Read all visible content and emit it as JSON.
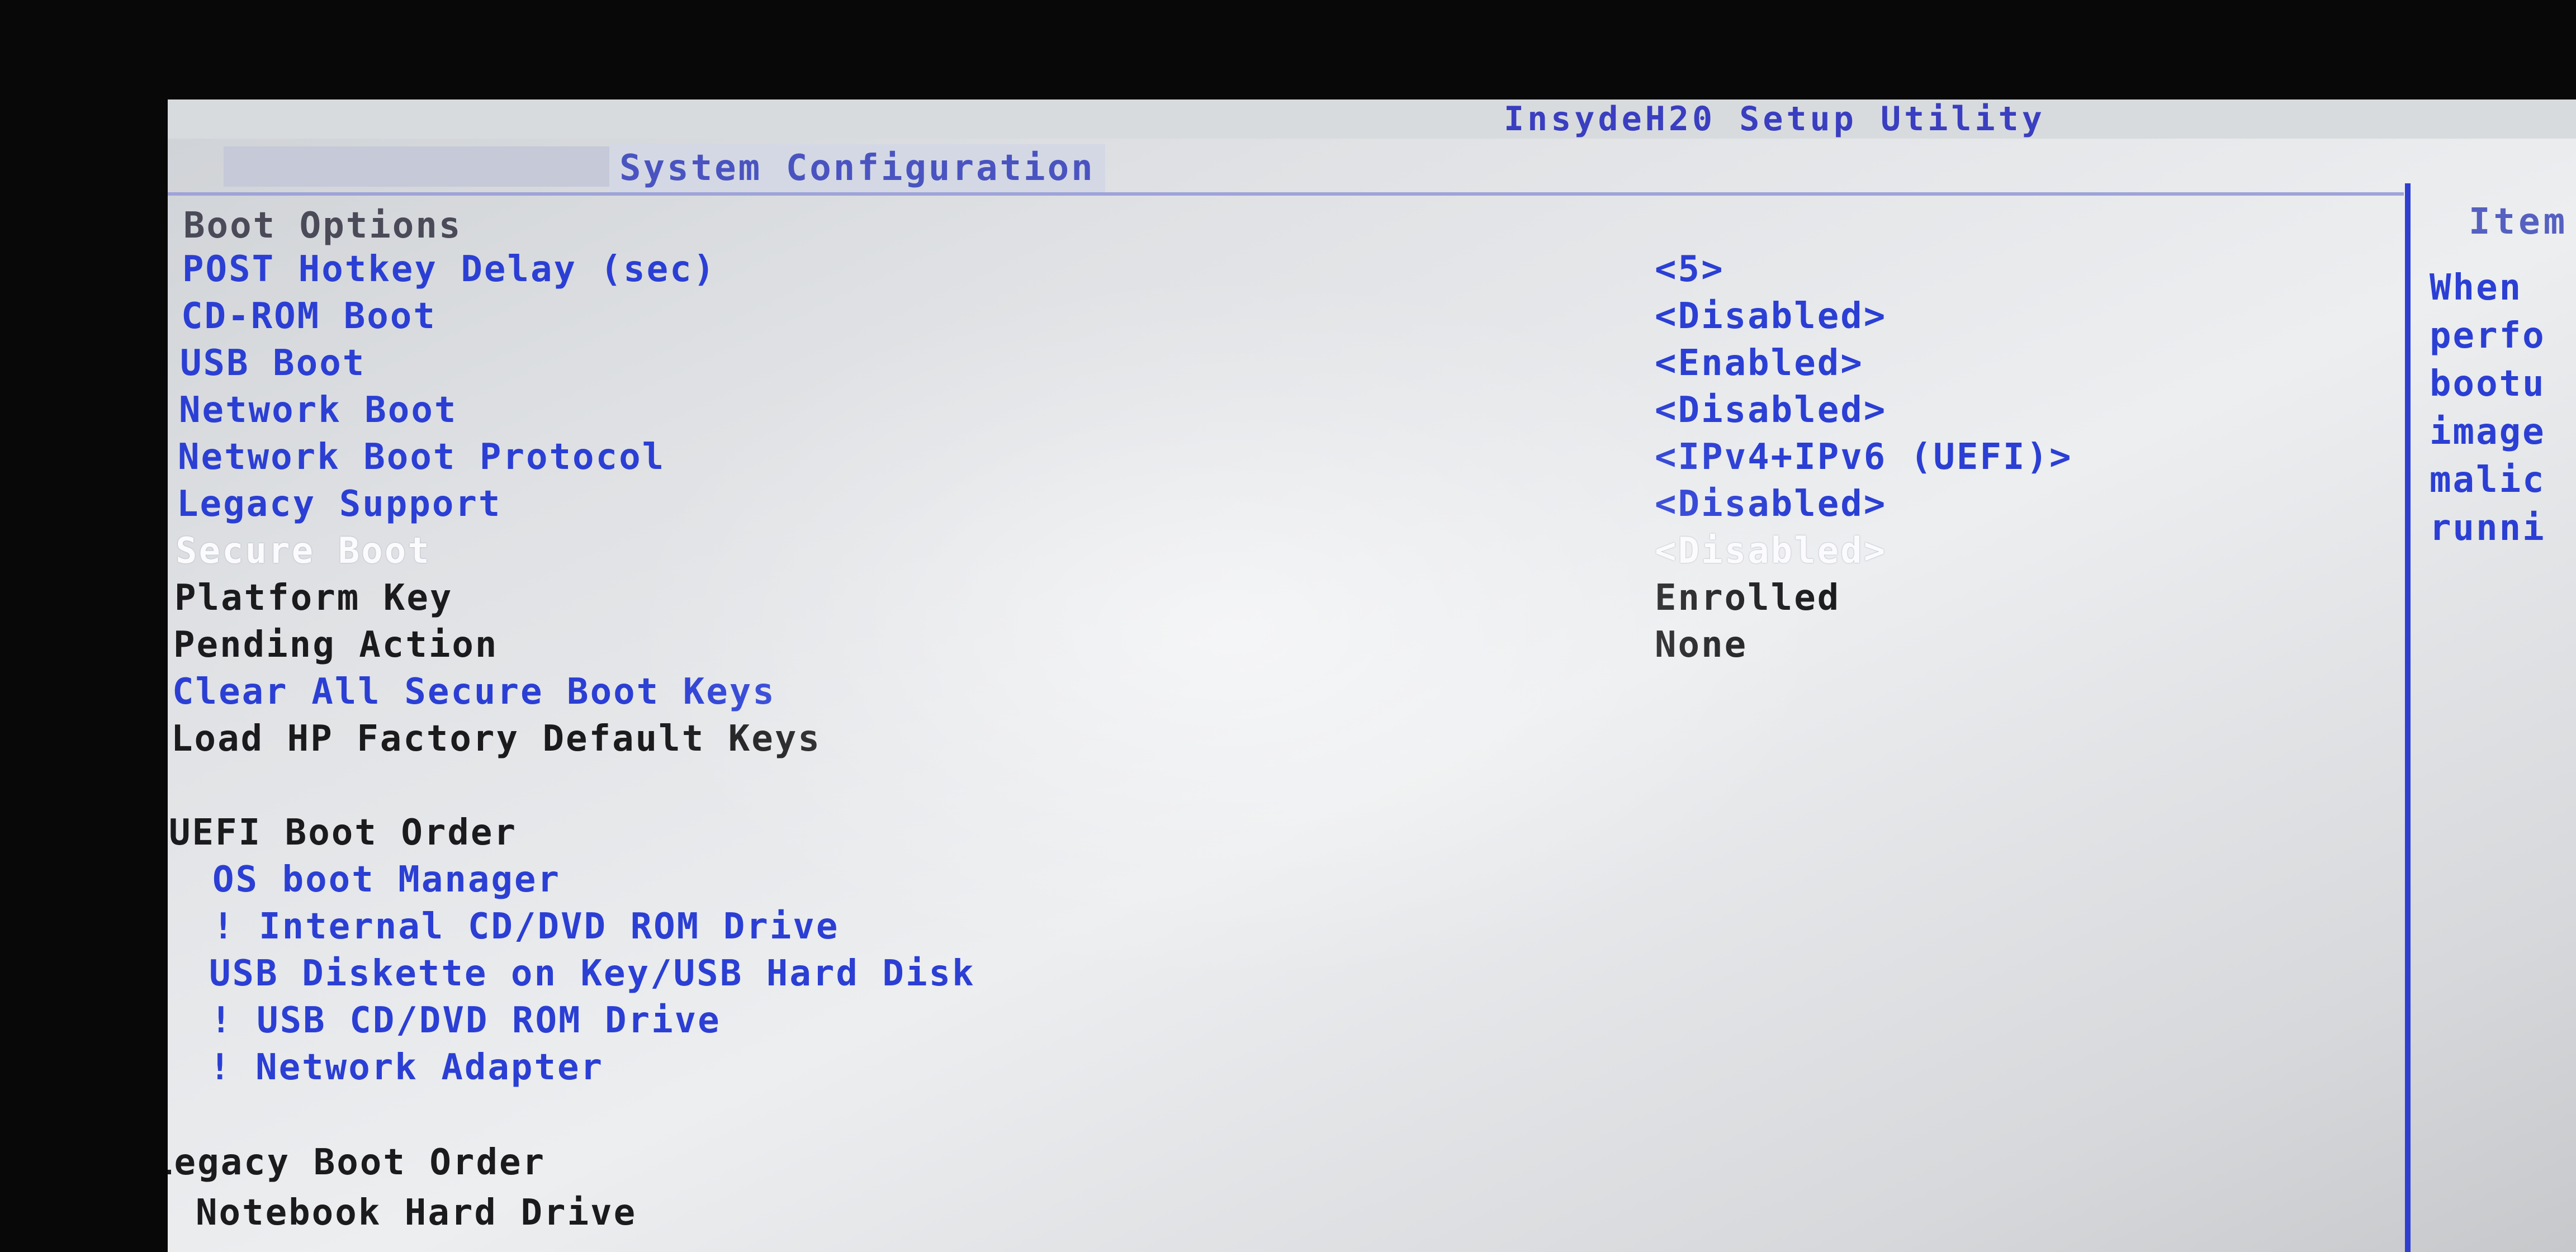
{
  "app": {
    "title": "InsydeH20 Setup Utility"
  },
  "tabs": {
    "active_label": "System Configuration"
  },
  "boot_options": {
    "header": "Boot Options",
    "items": [
      {
        "label": "POST Hotkey Delay (sec)",
        "value": "<5>"
      },
      {
        "label": "CD-ROM Boot",
        "value": "<Disabled>"
      },
      {
        "label": "USB Boot",
        "value": "<Enabled>"
      },
      {
        "label": "Network Boot",
        "value": "<Disabled>"
      },
      {
        "label": "Network Boot Protocol",
        "value": "<IPv4+IPv6 (UEFI)>"
      },
      {
        "label": "Legacy Support",
        "value": "<Disabled>"
      },
      {
        "label": "Secure Boot",
        "value": "<Disabled>"
      },
      {
        "label": "Platform Key",
        "value": "Enrolled"
      },
      {
        "label": "Pending Action",
        "value": "None"
      }
    ],
    "actions": [
      {
        "label": "Clear All Secure Boot Keys"
      },
      {
        "label": "Load HP Factory Default Keys"
      }
    ]
  },
  "uefi_boot_order": {
    "header": "UEFI Boot Order",
    "items": [
      "OS boot Manager",
      "! Internal CD/DVD ROM Drive",
      "USB Diskette on Key/USB Hard Disk",
      "! USB CD/DVD ROM Drive",
      "! Network Adapter"
    ]
  },
  "legacy_boot_order": {
    "header": "Legacy Boot Order",
    "items": [
      "Notebook Hard Drive"
    ]
  },
  "help_panel": {
    "title": "Item",
    "lines": [
      "When",
      "perfo",
      "bootu",
      "image",
      "malic",
      "runni"
    ]
  },
  "colors": {
    "screen_bg": "#dfe1e4",
    "selectable_text": "#2b3fd4",
    "static_text": "#1b1b1d",
    "highlighted_text": "#fbfbfd",
    "accent_divider": "#2f3fd0"
  }
}
